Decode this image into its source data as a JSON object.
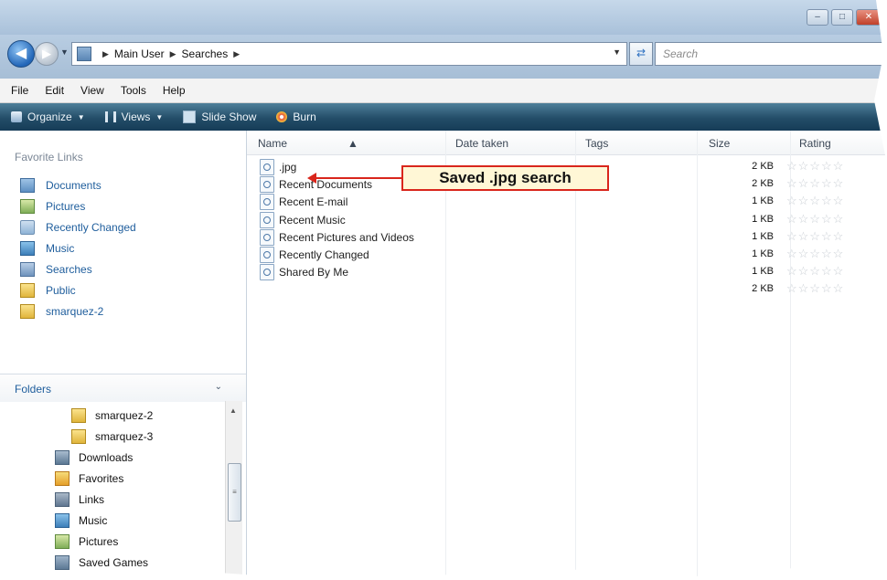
{
  "window": {
    "controls": [
      "minimize",
      "maximize",
      "close"
    ]
  },
  "address": {
    "crumbs": [
      "Main User",
      "Searches"
    ],
    "search_placeholder": "Search"
  },
  "menu": [
    "File",
    "Edit",
    "View",
    "Tools",
    "Help"
  ],
  "commands": [
    {
      "label": "Organize",
      "icon": "organize-icon",
      "dropdown": true
    },
    {
      "label": "Views",
      "icon": "views-icon",
      "dropdown": true
    },
    {
      "label": "Slide Show",
      "icon": "slideshow-icon",
      "dropdown": false
    },
    {
      "label": "Burn",
      "icon": "burn-icon",
      "dropdown": false
    }
  ],
  "navpane": {
    "favorites_title": "Favorite Links",
    "favorites": [
      {
        "label": "Documents",
        "icon": "documents-icon"
      },
      {
        "label": "Pictures",
        "icon": "pictures-icon"
      },
      {
        "label": "Recently Changed",
        "icon": "recently-changed-icon"
      },
      {
        "label": "Music",
        "icon": "music-icon"
      },
      {
        "label": "Searches",
        "icon": "searches-icon"
      },
      {
        "label": "Public",
        "icon": "folder-icon"
      },
      {
        "label": "smarquez-2",
        "icon": "folder-icon"
      }
    ],
    "folders_title": "Folders",
    "tree": [
      {
        "label": "smarquez-2",
        "icon": "folder-icon",
        "indent": 1
      },
      {
        "label": "smarquez-3",
        "icon": "folder-icon",
        "indent": 1
      },
      {
        "label": "Downloads",
        "icon": "downloads-icon",
        "indent": 0
      },
      {
        "label": "Favorites",
        "icon": "favorites-icon",
        "indent": 0
      },
      {
        "label": "Links",
        "icon": "links-icon",
        "indent": 0
      },
      {
        "label": "Music",
        "icon": "music-icon",
        "indent": 0
      },
      {
        "label": "Pictures",
        "icon": "pictures-icon",
        "indent": 0
      },
      {
        "label": "Saved Games",
        "icon": "saved-games-icon",
        "indent": 0
      }
    ]
  },
  "list": {
    "columns": [
      "Name",
      "Date taken",
      "Tags",
      "Size",
      "Rating"
    ],
    "rows": [
      {
        "name": ".jpg",
        "size": "2 KB"
      },
      {
        "name": "Recent Documents",
        "size": "2 KB"
      },
      {
        "name": "Recent E-mail",
        "size": "1 KB"
      },
      {
        "name": "Recent Music",
        "size": "1 KB"
      },
      {
        "name": "Recent Pictures and Videos",
        "size": "1 KB"
      },
      {
        "name": "Recently Changed",
        "size": "1 KB"
      },
      {
        "name": "Shared By Me",
        "size": "1 KB"
      },
      {
        "name": "",
        "size": "2 KB"
      }
    ],
    "rating_glyphs": "☆☆☆☆☆"
  },
  "callout": {
    "text": "Saved .jpg search",
    "color": "#d9261c"
  }
}
